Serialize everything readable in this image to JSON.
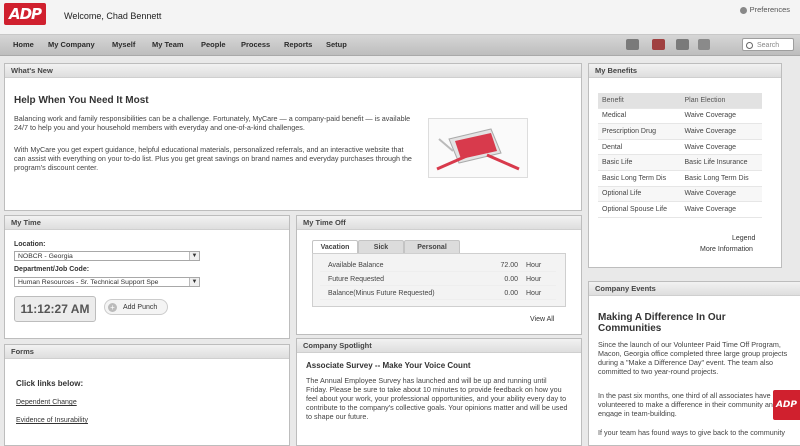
{
  "header": {
    "logo": "ADP",
    "welcome": "Welcome, Chad Bennett",
    "preferences": "Preferences"
  },
  "nav": {
    "items": [
      "Home",
      "My Company",
      "Myself",
      "My Team",
      "People",
      "Process",
      "Reports",
      "Setup"
    ],
    "search_placeholder": "Search"
  },
  "whats_new": {
    "header": "What's New",
    "title": "Help When You Need It Most",
    "para1": "Balancing work and family responsibilities can be a challenge. Fortunately, MyCare — a company-paid benefit — is available 24/7 to help you and your household members with everyday and one-of-a-kind challenges.",
    "para2": "With MyCare you get expert guidance, helpful educational materials, personalized referrals, and an interactive website that can assist with everything on your to-do list. Plus you get great savings on brand names and everyday purchases through the program's discount center."
  },
  "benefits": {
    "header": "My Benefits",
    "columns": [
      "Benefit",
      "Plan Election"
    ],
    "rows": [
      [
        "Medical",
        "Waive Coverage"
      ],
      [
        "Prescription Drug",
        "Waive Coverage"
      ],
      [
        "Dental",
        "Waive Coverage"
      ],
      [
        "Basic Life",
        "Basic Life Insurance"
      ],
      [
        "Basic Long Term Dis",
        "Basic Long Term Dis"
      ],
      [
        "Optional Life",
        "Waive Coverage"
      ],
      [
        "Optional Spouse Life",
        "Waive Coverage"
      ]
    ],
    "legend": "Legend",
    "more": "More Information"
  },
  "my_time": {
    "header": "My Time",
    "location_label": "Location:",
    "location_value": "NOBCR - Georgia",
    "dept_label": "Department/Job Code:",
    "dept_value": "Human Resources - Sr. Technical Support Spe",
    "clock": "11:12:27 AM",
    "add_punch": "Add Punch"
  },
  "my_time_off": {
    "header": "My Time Off",
    "tabs": [
      "Vacation",
      "Sick",
      "Personal"
    ],
    "rows": [
      {
        "label": "Available Balance",
        "value": "72.00",
        "unit": "Hour"
      },
      {
        "label": "Future Requested",
        "value": "0.00",
        "unit": "Hour"
      },
      {
        "label": "Balance(Minus Future Requested)",
        "value": "0.00",
        "unit": "Hour"
      }
    ],
    "view_all": "View All"
  },
  "forms": {
    "header": "Forms",
    "intro": "Click links below:",
    "links": [
      "Dependent Change",
      "Evidence of Insurability"
    ]
  },
  "spotlight": {
    "header": "Company Spotlight",
    "title": "Associate Survey -- Make Your Voice Count",
    "body": "The Annual Employee Survey has launched and will be up and running until Friday. Please be sure to take about 10 minutes to provide feedback on how you feel about your work, your professional opportunities, and your ability every day to contribute to the company's collective goals. Your opinions matter and will be used to shape our future."
  },
  "events": {
    "header": "Company Events",
    "title": "Making A Difference In Our Communities",
    "para1": "Since the launch of our Volunteer Paid Time Off Program, Macon, Georgia office completed three large group projects during a \"Make a Difference Day\" event. The team also committed to two year-round projects.",
    "para2": "In the past six months, one third of all associates have volunteered to make a difference in their community and engage in team-building.",
    "para3": "If your team has found ways to give back to the community"
  }
}
